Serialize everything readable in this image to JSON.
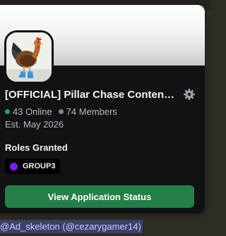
{
  "server": {
    "name": "[OFFICIAL] Pillar Chase Content ...",
    "online": "43 Online",
    "members": "74 Members",
    "established": "Est. May 2026"
  },
  "roles": {
    "heading": "Roles Granted",
    "items": [
      {
        "label": "GROUP3",
        "color": "#7c1dff"
      }
    ]
  },
  "actions": {
    "status_button": "View Application Status"
  },
  "mention": {
    "text": "@Ad_skeleton (@cezarygamer14)"
  },
  "colors": {
    "card_bg": "#111214",
    "button_green": "#248046",
    "online_dot": "#23a55a",
    "members_dot": "#80848e"
  },
  "icons": {
    "server_icon": "rooster-in-blue-boots-icon",
    "settings": "gear-icon"
  }
}
